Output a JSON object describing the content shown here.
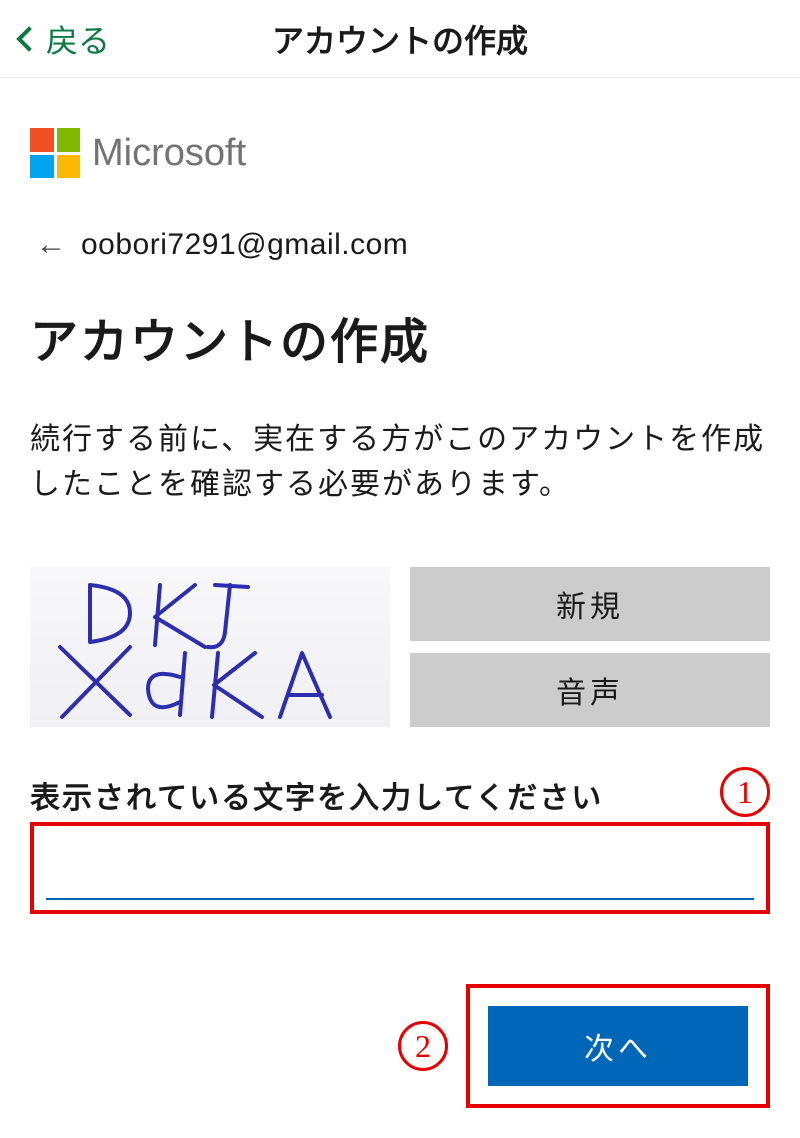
{
  "header": {
    "back_label": "戻る",
    "title": "アカウントの作成"
  },
  "brand": {
    "name": "Microsoft"
  },
  "email": "oobori7291@gmail.com",
  "page": {
    "heading": "アカウントの作成",
    "body_text": "続行する前に、実在する方がこのアカウントを作成したことを確認する必要があります。"
  },
  "captcha": {
    "new_label": "新規",
    "audio_label": "音声",
    "input_label": "表示されている文字を入力してください",
    "input_value": ""
  },
  "buttons": {
    "next_label": "次へ"
  },
  "annotations": {
    "one": "1",
    "two": "2"
  }
}
